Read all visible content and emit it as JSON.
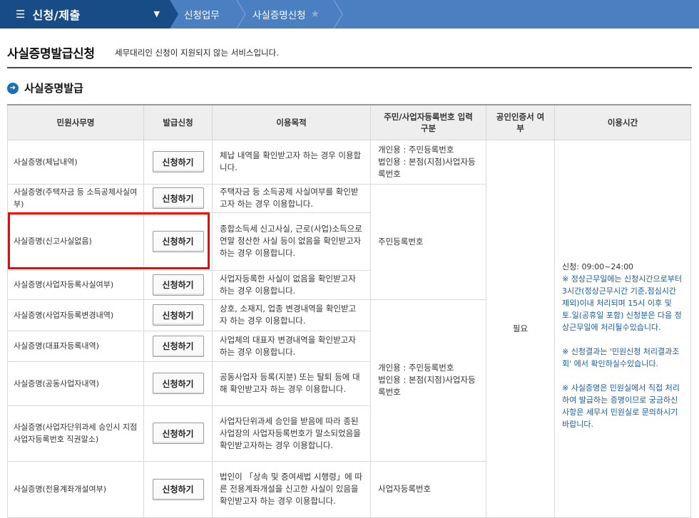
{
  "nav": {
    "menu_label": "신청/제출",
    "breadcrumb": [
      "신청업무",
      "사실증명신청"
    ]
  },
  "page": {
    "title": "사실증명발급신청",
    "subtitle": "세무대리인 신청이 지원되지 않는 서비스입니다."
  },
  "section": {
    "title": "사실증명발급"
  },
  "table": {
    "headers": {
      "name": "민원사무명",
      "apply": "발급신청",
      "purpose": "이용목적",
      "id": "주민/사업자등록번호 입력구분",
      "cert": "공인인증서 여부",
      "time": "이용시간"
    },
    "apply_label": "신청하기",
    "rows": [
      {
        "name": "사실증명(체납내역)",
        "purpose": "체납 내역을 확인받고자 하는 경우 이용합니다."
      },
      {
        "name": "사실증명(주택자금 등 소득공제사실여부)",
        "purpose": "주택자금 등 소득공제 사실여부를 확인받고자 하는 경우 이용합니다."
      },
      {
        "name": "사실증명(신고사실없음)",
        "purpose": "종합소득세 신고사실, 근로(사업)소득으로 연말 정산한 사실 등이 없음을 확인받고자 하는 경우 이용합니다."
      },
      {
        "name": "사실증명(사업자등록사실여부)",
        "purpose": "사업자등록한 사실이 없음을 확인받고자 하는 경우 이용합니다."
      },
      {
        "name": "사실증명(사업자등록변경내역)",
        "purpose": "상호, 소재지, 업종 변경내역을 확인받고자 하는 경우 이용합니다."
      },
      {
        "name": "사실증명(대표자등록내역)",
        "purpose": "사업체의 대표자 변경내역을 확인받고자 하는 경우 이용합니다."
      },
      {
        "name": "사실증명(공동사업자내역)",
        "purpose": "공동사업자 등록(지분) 또는 탈퇴 등에 대해 확인받고자 하는 경우 이용합니다."
      },
      {
        "name": "사실증명(사업자단위과세 승인시 지점사업자등록번호 직권말소)",
        "purpose": "사업자단위과세 승인을 받음에 따라 종된 사업장의 사업자등록번호가 말소되었음을 확인받고자하는 경우 이용합니다."
      },
      {
        "name": "사실증명(전용계좌개설여부)",
        "purpose": "법인이 「상속 및 증여세법 시행령」에 따른 전용계좌개설을 신고한 사실이 있음을 확인받고자 하는 경우 이용합니다."
      }
    ],
    "id_groups": [
      "개인용 : 주민등록번호\n법인용 : 본점(지점)사업자등록번호",
      "주민등록번호",
      "개인용 : 주민등록번호\n법인용 : 본점(지점)사업자등록번호",
      "사업자등록번호"
    ],
    "cert_value": "필요",
    "time": {
      "hours": "신청: 09:00~24:00",
      "note1": "※ 정상근무일에는 신청시간으로부터 3시간(정상근무시간 기준,점심시간 제외)이내 처리되며 15시 이후 및 토.일(공휴일 포함) 신청분은 다음 정상근무일에 처리될수있습니다.",
      "note2": "※ 신청결과는 '민원신청 처리결과조회' 에서 확인하실수있습니다.",
      "note3": "※ 사실증명은 민원실에서 직접 처리하여 발급하는 증명이므로 궁금하신 사항은 세무서 민원실로 문의하시기바랍니다."
    }
  }
}
